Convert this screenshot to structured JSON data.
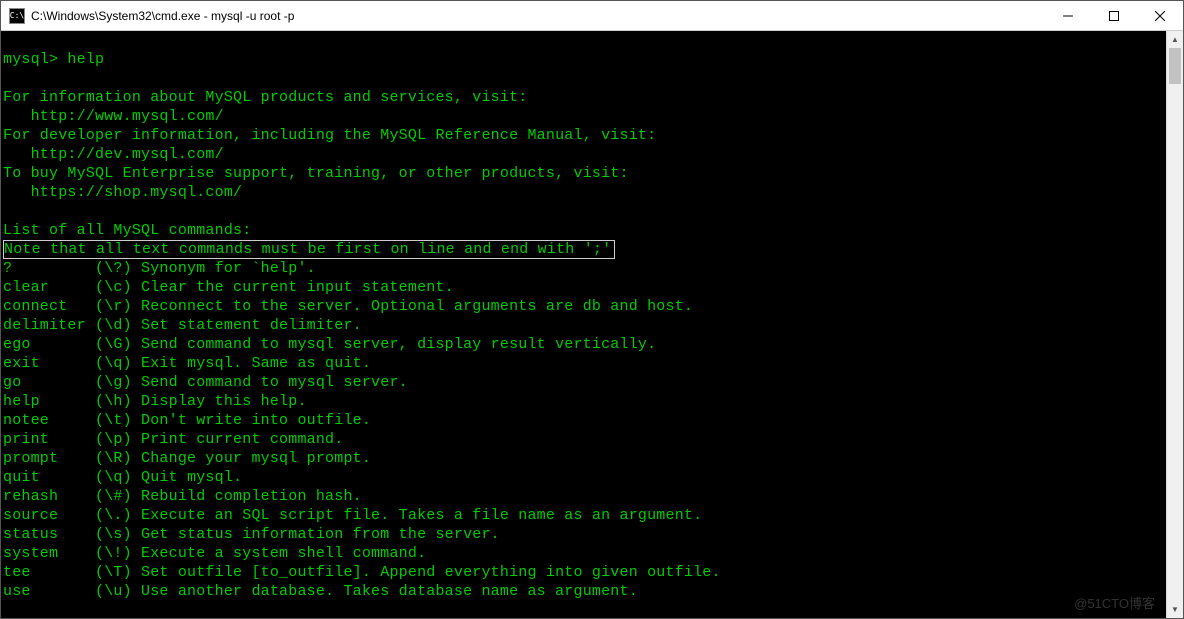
{
  "window": {
    "title": "C:\\Windows\\System32\\cmd.exe - mysql  -u root -p",
    "icon_label": "C:\\"
  },
  "terminal": {
    "blank0": "",
    "prompt_line": "mysql> help",
    "blank1": "",
    "info1": "For information about MySQL products and services, visit:",
    "info1_url": "   http://www.mysql.com/",
    "info2": "For developer information, including the MySQL Reference Manual, visit:",
    "info2_url": "   http://dev.mysql.com/",
    "info3": "To buy MySQL Enterprise support, training, or other products, visit:",
    "info3_url": "   https://shop.mysql.com/",
    "blank2": "",
    "list_hdr": "List of all MySQL commands:",
    "note_line": "Note that all text commands must be first on line and end with ';'",
    "commands": [
      {
        "name": "?",
        "short": "(\\?)",
        "desc": "Synonym for `help'."
      },
      {
        "name": "clear",
        "short": "(\\c)",
        "desc": "Clear the current input statement."
      },
      {
        "name": "connect",
        "short": "(\\r)",
        "desc": "Reconnect to the server. Optional arguments are db and host."
      },
      {
        "name": "delimiter",
        "short": "(\\d)",
        "desc": "Set statement delimiter."
      },
      {
        "name": "ego",
        "short": "(\\G)",
        "desc": "Send command to mysql server, display result vertically."
      },
      {
        "name": "exit",
        "short": "(\\q)",
        "desc": "Exit mysql. Same as quit."
      },
      {
        "name": "go",
        "short": "(\\g)",
        "desc": "Send command to mysql server."
      },
      {
        "name": "help",
        "short": "(\\h)",
        "desc": "Display this help."
      },
      {
        "name": "notee",
        "short": "(\\t)",
        "desc": "Don't write into outfile."
      },
      {
        "name": "print",
        "short": "(\\p)",
        "desc": "Print current command."
      },
      {
        "name": "prompt",
        "short": "(\\R)",
        "desc": "Change your mysql prompt."
      },
      {
        "name": "quit",
        "short": "(\\q)",
        "desc": "Quit mysql."
      },
      {
        "name": "rehash",
        "short": "(\\#)",
        "desc": "Rebuild completion hash."
      },
      {
        "name": "source",
        "short": "(\\.)",
        "desc": "Execute an SQL script file. Takes a file name as an argument."
      },
      {
        "name": "status",
        "short": "(\\s)",
        "desc": "Get status information from the server."
      },
      {
        "name": "system",
        "short": "(\\!)",
        "desc": "Execute a system shell command."
      },
      {
        "name": "tee",
        "short": "(\\T)",
        "desc": "Set outfile [to_outfile]. Append everything into given outfile."
      },
      {
        "name": "use",
        "short": "(\\u)",
        "desc": "Use another database. Takes database name as argument."
      }
    ]
  },
  "watermark": "@51CTO博客"
}
